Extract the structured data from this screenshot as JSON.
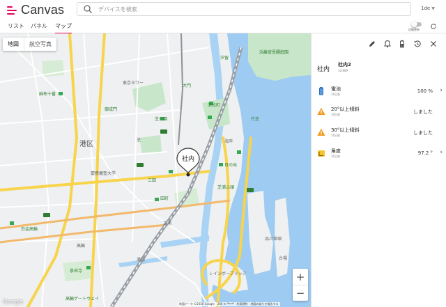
{
  "app": {
    "name": "Canvas",
    "brand_color": "#e6005c"
  },
  "search": {
    "placeholder": "デバイスを検索",
    "icon": "search-icon"
  },
  "user": {
    "label": "1de"
  },
  "nav": {
    "tabs": [
      {
        "label": "リスト",
        "active": false
      },
      {
        "label": "パネル",
        "active": false
      },
      {
        "label": "マップ",
        "active": true
      }
    ],
    "auto_update_label": "自動更新",
    "auto_update_on": false
  },
  "map": {
    "type_buttons": [
      "地図",
      "航空写真"
    ],
    "pin_label": "社内",
    "zoom_in": "+",
    "zoom_out": "−",
    "attribution": "地図データ ©2020 Google　200 m ┗━━┛　利用規約　地図の誤りを報告する",
    "google": "Google",
    "labels": [
      {
        "text": "港区",
        "color": "#555",
        "bold": true
      },
      {
        "text": "浜松町",
        "color": "#2e7d32"
      },
      {
        "text": "竹芝",
        "color": "#2e7d32"
      },
      {
        "text": "三田",
        "color": "#2e7d32"
      },
      {
        "text": "田町",
        "color": "#2e7d32"
      },
      {
        "text": "日の出",
        "color": "#2e7d32"
      },
      {
        "text": "芝公園",
        "color": "#2e7d32"
      },
      {
        "text": "御成門",
        "color": "#2e7d32"
      },
      {
        "text": "麻布十番",
        "color": "#2e7d32"
      },
      {
        "text": "白金高輪",
        "color": "#2e7d32"
      },
      {
        "text": "大門",
        "color": "#2e7d32"
      },
      {
        "text": "汐留",
        "color": "#2e7d32"
      },
      {
        "text": "浜離宮恩賜庭園",
        "color": "#2e7d32"
      },
      {
        "text": "芝浦ふ頭",
        "color": "#2e7d32"
      },
      {
        "text": "芝浦",
        "color": "#666"
      },
      {
        "text": "海岸",
        "color": "#666"
      },
      {
        "text": "芝",
        "color": "#666"
      },
      {
        "text": "東京タワー",
        "color": "#666"
      },
      {
        "text": "慶應義塾大学",
        "color": "#666"
      },
      {
        "text": "高輪",
        "color": "#666"
      },
      {
        "text": "港南",
        "color": "#666"
      },
      {
        "text": "台場",
        "color": "#666"
      },
      {
        "text": "泉岳寺",
        "color": "#2e7d32"
      },
      {
        "text": "高輪ゲートウェイ",
        "color": "#2e7d32"
      },
      {
        "text": "レインボーブリッジ",
        "color": "#666"
      },
      {
        "text": "品川埠頭",
        "color": "#666"
      }
    ]
  },
  "panel": {
    "tools": [
      "edit-icon",
      "bell-icon",
      "battery-settings-icon",
      "history-icon",
      "close-icon"
    ],
    "device_name": "社内",
    "location": "社内2",
    "location_sub": "12/889",
    "rows": [
      {
        "title": "電池",
        "sub": "16日前",
        "value": "100 %",
        "icon": "battery-icon",
        "chevron": true
      },
      {
        "title": "20°以上傾斜",
        "sub": "16日前",
        "value": "しました",
        "icon": "warning-icon",
        "chevron": false
      },
      {
        "title": "30°以上傾斜",
        "sub": "16日前",
        "value": "しました",
        "icon": "warning-icon",
        "chevron": false
      },
      {
        "title": "角度",
        "sub": "16日前",
        "value": "97.2 °",
        "icon": "angle-icon",
        "chevron": true
      }
    ]
  }
}
